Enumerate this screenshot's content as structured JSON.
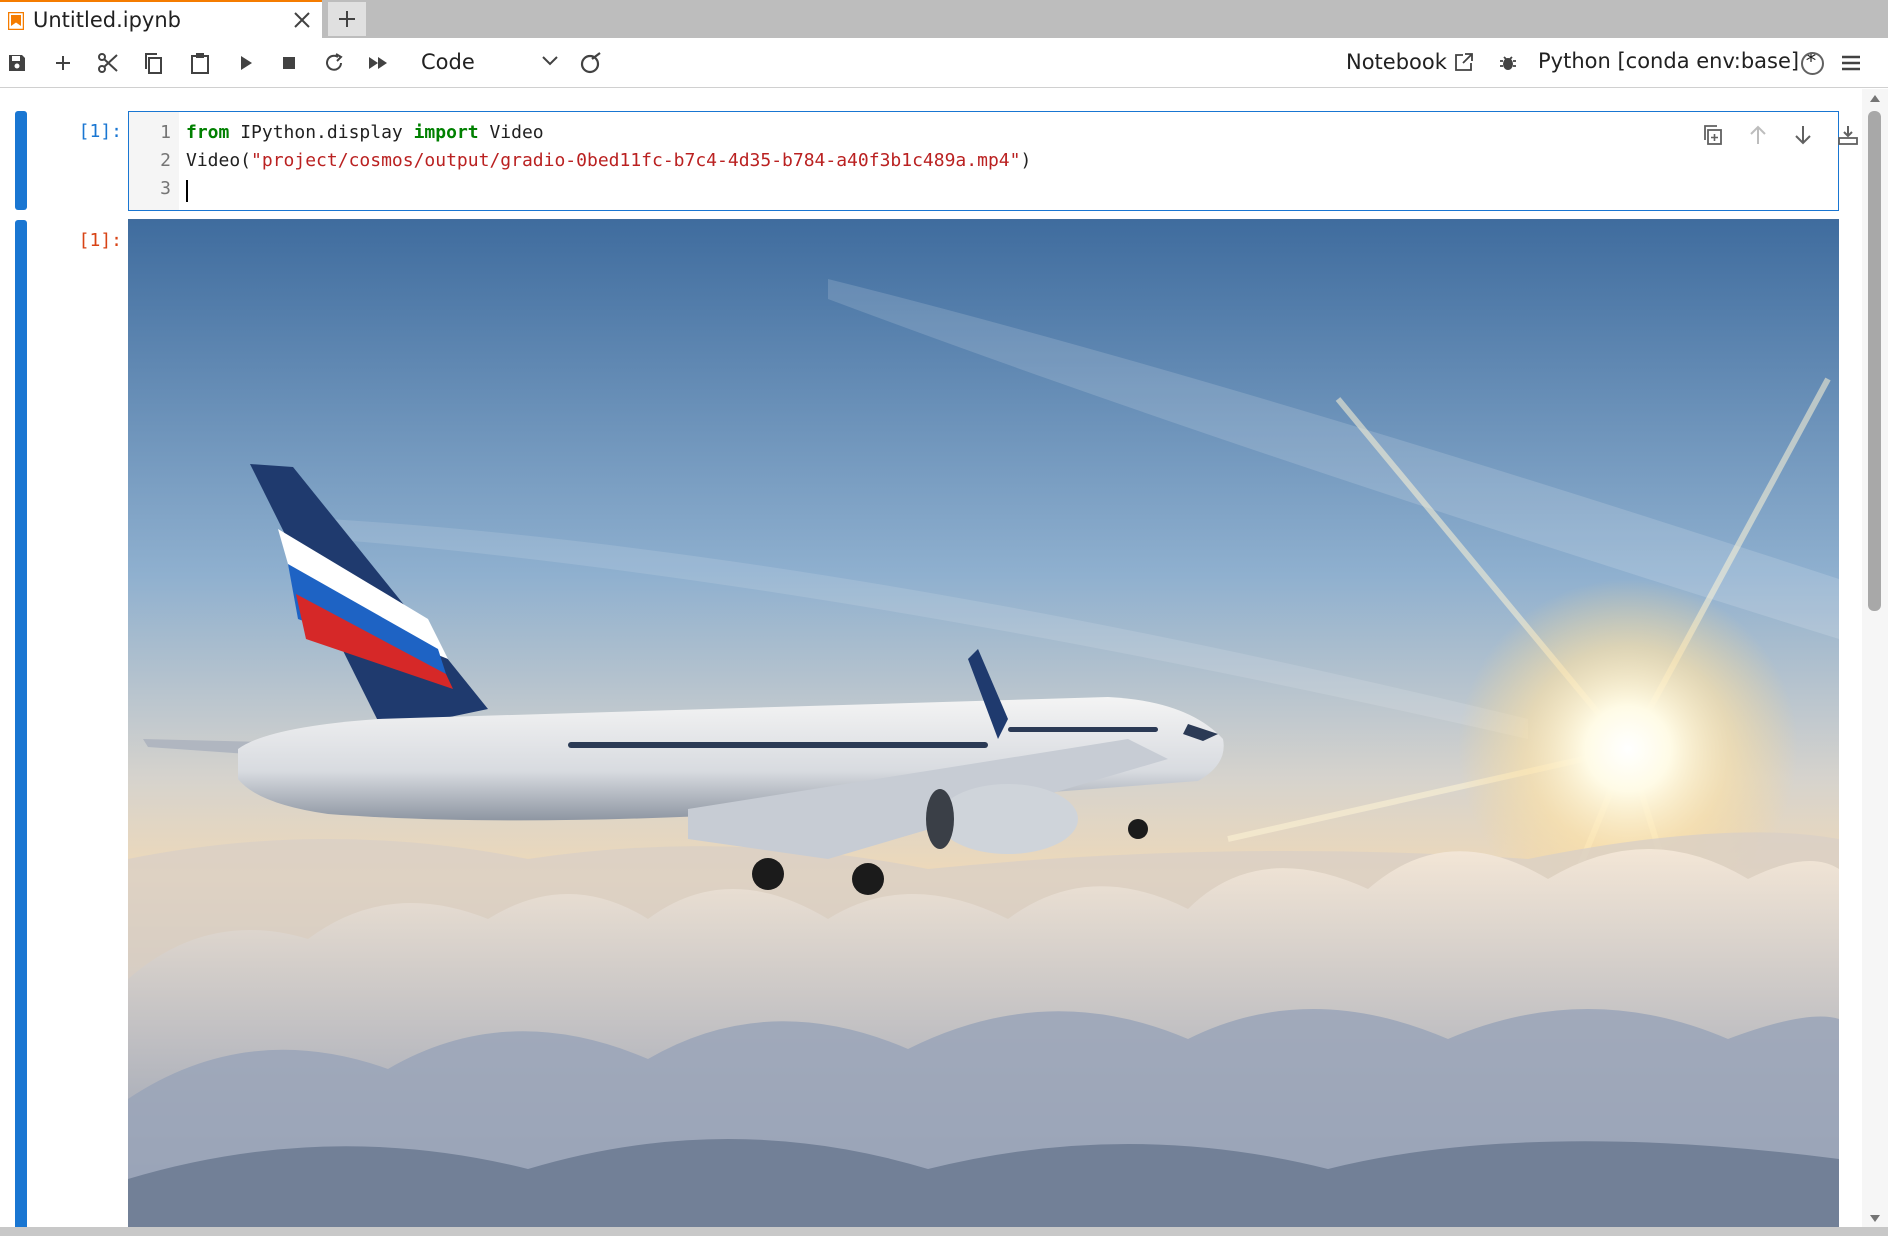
{
  "tab": {
    "title": "Untitled.ipynb"
  },
  "toolbar": {
    "cell_type": "Code",
    "notebook_label": "Notebook",
    "kernel_name": "Python [conda env:base] *",
    "icons": [
      "save-icon",
      "add-cell-icon",
      "cut-icon",
      "copy-icon",
      "paste-icon",
      "run-icon",
      "interrupt-icon",
      "restart-icon",
      "run-all-icon",
      "git-icon",
      "external-link-icon",
      "debugger-icon",
      "kernel-status-icon",
      "menu-icon"
    ]
  },
  "cell": {
    "input_prompt": "[1]:",
    "output_prompt": "[1]:",
    "line_numbers": [
      "1",
      "2",
      "3"
    ],
    "code": {
      "line1_kw1": "from",
      "line1_mid": " IPython.display ",
      "line1_kw2": "import",
      "line1_end": " Video",
      "line2_pre": "Video(",
      "line2_str": "\"project/cosmos/output/gradio-0bed11fc-b7c4-4d35-b784-a40f3b1c489a.mp4\"",
      "line2_post": ")"
    },
    "cell_toolbar_icons": [
      "duplicate-cell-icon",
      "move-up-icon",
      "move-down-icon",
      "insert-below-icon",
      "insert-above-icon",
      "delete-cell-icon"
    ],
    "output_media": "video frame: airliner with red white blue tail flying above clouds at sunset"
  },
  "colors": {
    "accent": "#1976d2",
    "tab_accent": "#f57c00",
    "output_prompt": "#d84315",
    "keyword": "#008000",
    "string": "#ba2121"
  }
}
